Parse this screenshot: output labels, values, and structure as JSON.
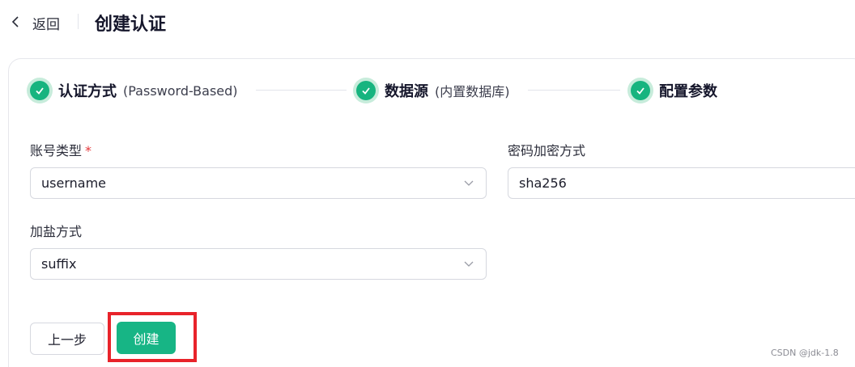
{
  "header": {
    "back_label": "返回",
    "title": "创建认证"
  },
  "steps": [
    {
      "title": "认证方式",
      "subtitle": "(Password-Based)",
      "status": "completed"
    },
    {
      "title": "数据源",
      "subtitle": "(内置数据库)",
      "status": "completed"
    },
    {
      "title": "配置参数",
      "subtitle": "",
      "status": "completed"
    }
  ],
  "form": {
    "account_type": {
      "label": "账号类型",
      "required_mark": "*",
      "value": "username"
    },
    "password_hash": {
      "label": "密码加密方式",
      "value": "sha256"
    },
    "salt_position": {
      "label": "加盐方式",
      "value": "suffix"
    }
  },
  "actions": {
    "prev_label": "上一步",
    "create_label": "创建"
  },
  "watermark": "CSDN @jdk-1.8",
  "colors": {
    "accent": "#17b585",
    "highlight": "#e8232a",
    "required": "#e5383b"
  }
}
